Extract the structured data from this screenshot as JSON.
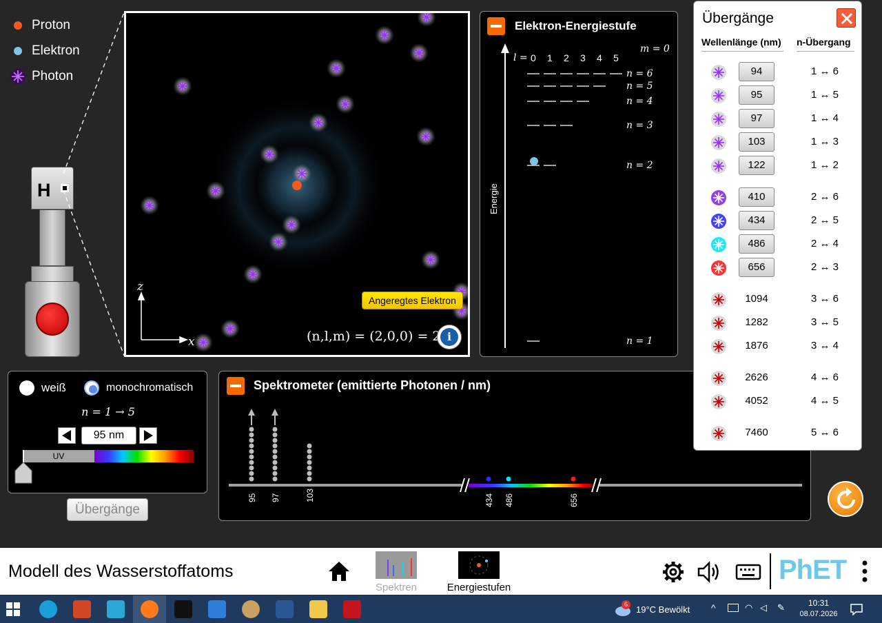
{
  "legend": {
    "items": [
      {
        "label": "Proton",
        "color": "#f45a1e"
      },
      {
        "label": "Elektron",
        "color": "#7cc4e8"
      },
      {
        "label": "Photon",
        "color": "#9b30ff"
      }
    ]
  },
  "gun": {
    "element_label": "H"
  },
  "atom_view": {
    "excited_button": "Angeregtes Elektron",
    "state_label": "(n,l,m) = (2,0,0) = 2s",
    "axis_x": "x",
    "axis_z": "z"
  },
  "energy_panel": {
    "title": "Elektron-Energiestufe",
    "axis_label": "Energie",
    "l_label": "l =",
    "l_values": [
      "0",
      "1",
      "2",
      "3",
      "4",
      "5"
    ],
    "m_label": "m = 0",
    "levels": [
      "n = 6",
      "n = 5",
      "n = 4",
      "n = 3",
      "n = 2",
      "n = 1"
    ]
  },
  "controls": {
    "radio_white": "weiß",
    "radio_mono": "monochromatisch",
    "mono_selected": true,
    "transition_label": "n = 1 → 5",
    "wavelength_value": "95 nm",
    "uv_label": "UV"
  },
  "transitions_button": "Übergänge",
  "spectrometer": {
    "title": "Spektrometer (emittierte Photonen / nm)",
    "columns": [
      {
        "label": "95",
        "count": 10,
        "overflow": true
      },
      {
        "label": "97",
        "count": 10,
        "overflow": true
      },
      {
        "label": "103",
        "count": 7,
        "overflow": false
      }
    ],
    "visible_marks": [
      "434",
      "486",
      "656"
    ],
    "mark_colors": [
      "#2d2dff",
      "#00e5ff",
      "#ff1a1a"
    ]
  },
  "transitions_dialog": {
    "title": "Übergänge",
    "col_wavelength": "Wellenlänge (nm)",
    "col_transition": "n-Übergang",
    "rows": [
      {
        "wl": "94",
        "tr": "1 ↔ 6",
        "button": true,
        "color": "#9b30ff"
      },
      {
        "wl": "95",
        "tr": "1 ↔ 5",
        "button": true,
        "color": "#9b30ff"
      },
      {
        "wl": "97",
        "tr": "1 ↔ 4",
        "button": true,
        "color": "#9b30ff"
      },
      {
        "wl": "103",
        "tr": "1 ↔ 3",
        "button": true,
        "color": "#9b30ff"
      },
      {
        "wl": "122",
        "tr": "1 ↔ 2",
        "button": true,
        "color": "#9b30ff"
      },
      {
        "wl": "410",
        "tr": "2 ↔ 6",
        "button": true,
        "color": "#8a2be2"
      },
      {
        "wl": "434",
        "tr": "2 ↔ 5",
        "button": true,
        "color": "#2d2dff"
      },
      {
        "wl": "486",
        "tr": "2 ↔ 4",
        "button": true,
        "color": "#00e5ff"
      },
      {
        "wl": "656",
        "tr": "2 ↔ 3",
        "button": true,
        "color": "#ff1a1a"
      },
      {
        "wl": "1094",
        "tr": "3 ↔ 6",
        "button": false,
        "color": "#c00000"
      },
      {
        "wl": "1282",
        "tr": "3 ↔ 5",
        "button": false,
        "color": "#c00000"
      },
      {
        "wl": "1876",
        "tr": "3 ↔ 4",
        "button": false,
        "color": "#c00000"
      },
      {
        "wl": "2626",
        "tr": "4 ↔ 6",
        "button": false,
        "color": "#c00000"
      },
      {
        "wl": "4052",
        "tr": "4 ↔ 5",
        "button": false,
        "color": "#c00000"
      },
      {
        "wl": "7460",
        "tr": "5 ↔ 6",
        "button": false,
        "color": "#c00000"
      }
    ]
  },
  "navbar": {
    "title": "Modell des Wasserstoffatoms",
    "tabs": [
      {
        "label": "Spektren",
        "active": false
      },
      {
        "label": "Energiestufen",
        "active": true
      }
    ],
    "logo": "PhET"
  },
  "taskbar": {
    "weather_badge": "6",
    "weather": "19°C  Bewölkt",
    "time": "10:31",
    "date": "08.07.2026"
  }
}
